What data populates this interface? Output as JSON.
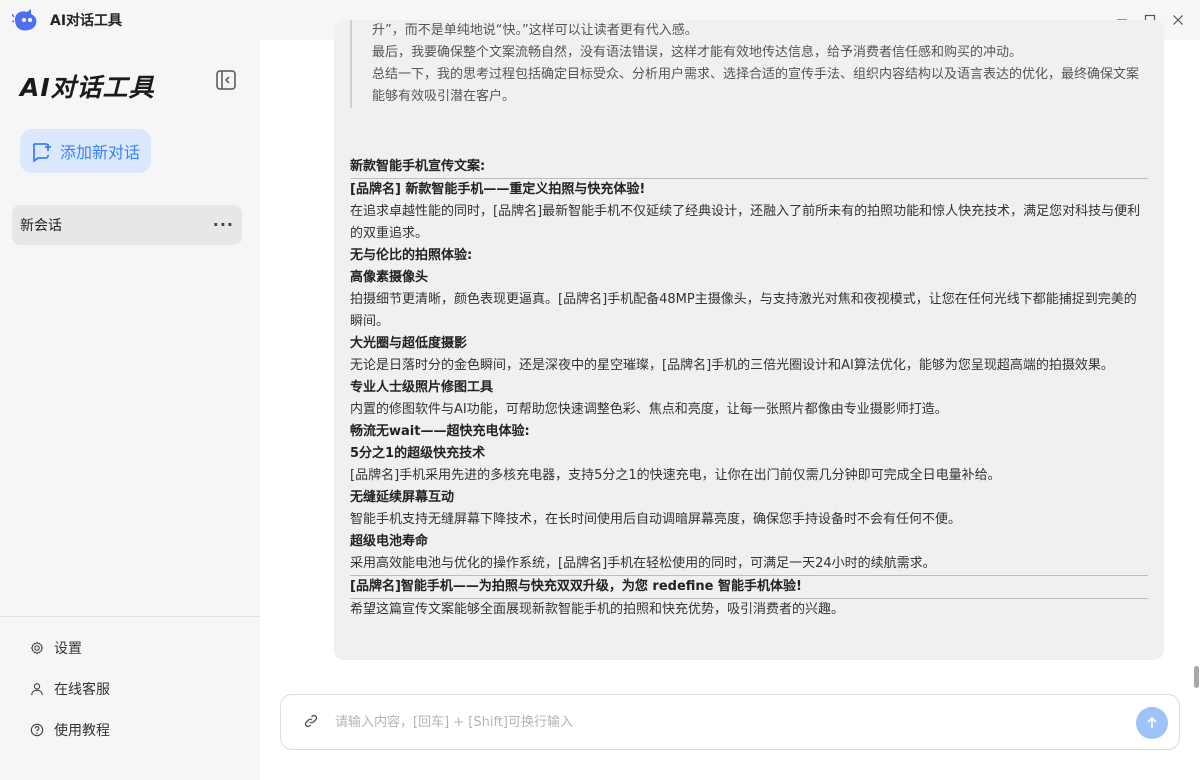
{
  "window": {
    "title": "AI对话工具"
  },
  "sidebar": {
    "brand": "AI对话工具",
    "new_chat_label": "添加新对话",
    "sessions": [
      {
        "label": "新会话",
        "more": "···"
      }
    ],
    "links": [
      {
        "label": "设置",
        "icon": "gear-icon"
      },
      {
        "label": "在线客服",
        "icon": "user-icon"
      },
      {
        "label": "使用教程",
        "icon": "help-icon"
      }
    ]
  },
  "thinking": [
    "升”，而不是单纯地说“快。”这样可以让读者更有代入感。",
    "最后，我要确保整个文案流畅自然，没有语法错误，这样才能有效地传达信息，给予消费者信任感和购买的冲动。",
    "总结一下，我的思考过程包括确定目标受众、分析用户需求、选择合适的宣传手法、组织内容结构以及语言表达的优化，最终确保文案能够有效吸引潜在客户。"
  ],
  "answer": {
    "heading": "新款智能手机宣传文案:",
    "title": "[品牌名] 新款智能手机——重定义拍照与快充体验!",
    "intro": "在追求卓越性能的同时，[品牌名]最新智能手机不仅延续了经典设计，还融入了前所未有的拍照功能和惊人快充技术，满足您对科技与便利的双重追求。",
    "section1": "无与伦比的拍照体验:",
    "s1_h1": "高像素摄像头",
    "s1_p1": "拍摄细节更清晰，颜色表现更逼真。[品牌名]手机配备48MP主摄像头，与支持激光对焦和夜视模式，让您在任何光线下都能捕捉到完美的瞬间。",
    "s1_h2": "大光圈与超低度摄影",
    "s1_p2": "无论是日落时分的金色瞬间，还是深夜中的星空璀璨，[品牌名]手机的三倍光圈设计和AI算法优化，能够为您呈现超高端的拍摄效果。",
    "s1_h3": "专业人士级照片修图工具",
    "s1_p3": "内置的修图软件与AI功能，可帮助您快速调整色彩、焦点和亮度，让每一张照片都像由专业摄影师打造。",
    "section2": "畅流无wait——超快充电体验:",
    "s2_h1": "5分之1的超级快充技术",
    "s2_p1": "[品牌名]手机采用先进的多核充电器，支持5分之1的快速充电，让你在出门前仅需几分钟即可完成全日电量补给。",
    "s2_h2": "无缝延续屏幕互动",
    "s2_p2": "智能手机支持无缝屏幕下降技术，在长时间使用后自动调暗屏幕亮度，确保您手持设备时不会有任何不便。",
    "s2_h3": "超级电池寿命",
    "s2_p3": "采用高效能电池与优化的操作系统，[品牌名]手机在轻松使用的同时，可满足一天24小时的续航需求。",
    "slogan": "[品牌名]智能手机——为拍照与快充双双升级，为您 redefine 智能手机体验!",
    "closing": "希望这篇宣传文案能够全面展现新款智能手机的拍照和快充优势，吸引消费者的兴趣。"
  },
  "composer": {
    "placeholder": "请输入内容，[回车] + [Shift]可换行输入"
  },
  "colors": {
    "accent": "#3b82f6",
    "send_button": "#9ec3f8",
    "new_chat_bg": "#dbe8fb"
  }
}
